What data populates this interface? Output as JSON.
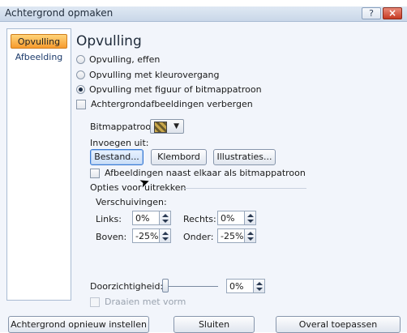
{
  "window": {
    "title": "Achtergrond opmaken",
    "help_label": "?",
    "close_label": "×"
  },
  "sidebar": {
    "items": [
      {
        "label": "Opvulling"
      },
      {
        "label": "Afbeelding"
      }
    ]
  },
  "panel": {
    "heading": "Opvulling",
    "fill_options": [
      {
        "label": "Opvulling, effen"
      },
      {
        "label": "Opvulling met kleurovergang"
      },
      {
        "label": "Opvulling met figuur of bitmappatroon"
      }
    ],
    "hide_background_label": "Achtergrondafbeeldingen verbergen",
    "bitmap_label": "Bitmappatroon:",
    "insert_from_label": "Invoegen uit:",
    "insert_buttons": {
      "file": "Bestand...",
      "clipboard": "Klembord",
      "clipart": "Illustraties..."
    },
    "tile_label": "Afbeeldingen naast elkaar als bitmappatroon",
    "stretch_title": "Opties voor uitrekken",
    "offsets_label": "Verschuivingen:",
    "offsets": {
      "left_label": "Links:",
      "left_value": "0%",
      "right_label": "Rechts:",
      "right_value": "0%",
      "top_label": "Boven:",
      "top_value": "-25%",
      "bottom_label": "Onder:",
      "bottom_value": "-25%"
    },
    "transparency_label": "Doorzichtigheid:",
    "transparency_value": "0%",
    "rotate_label": "Draaien met vorm"
  },
  "footer": {
    "reset_label": "Achtergrond opnieuw instellen",
    "close_label": "Sluiten",
    "apply_all_label": "Overal toepassen"
  }
}
